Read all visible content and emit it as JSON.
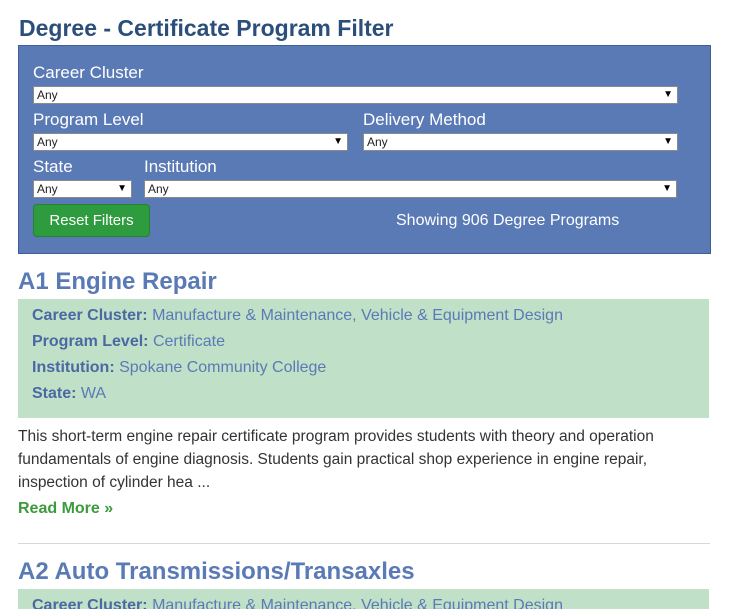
{
  "page": {
    "title": "Degree - Certificate Program Filter"
  },
  "filters": {
    "career_cluster": {
      "label": "Career Cluster",
      "value": "Any"
    },
    "program_level": {
      "label": "Program Level",
      "value": "Any"
    },
    "delivery_method": {
      "label": "Delivery Method",
      "value": "Any"
    },
    "state": {
      "label": "State",
      "value": "Any"
    },
    "institution": {
      "label": "Institution",
      "value": "Any"
    },
    "reset_label": "Reset Filters",
    "showing_text": "Showing 906 Degree Programs",
    "dropdown_icon": "caret-down"
  },
  "programs": [
    {
      "title": "A1 Engine Repair",
      "career_cluster_label": "Career Cluster:",
      "career_cluster": "Manufacture & Maintenance, Vehicle & Equipment Design",
      "program_level_label": "Program Level:",
      "program_level": "Certificate",
      "institution_label": "Institution:",
      "institution": "Spokane Community College",
      "state_label": "State:",
      "state": "WA",
      "description": "This short-term engine repair certificate program provides students with theory and operation fundamentals of engine diagnosis. Students gain practical shop experience in engine repair, inspection of cylinder hea ...",
      "read_more": "Read More »"
    },
    {
      "title": "A2 Auto Transmissions/Transaxles",
      "career_cluster_label": "Career Cluster:",
      "career_cluster": "Manufacture & Maintenance, Vehicle & Equipment Design"
    }
  ],
  "colors": {
    "filter_bg": "#5a7ab6",
    "title_blue": "#2b4f7a",
    "program_title": "#5a7ab6",
    "meta_bg": "#c0e0c7",
    "reset_green": "#2e9b3e",
    "read_more_green": "#3d9a3d"
  }
}
